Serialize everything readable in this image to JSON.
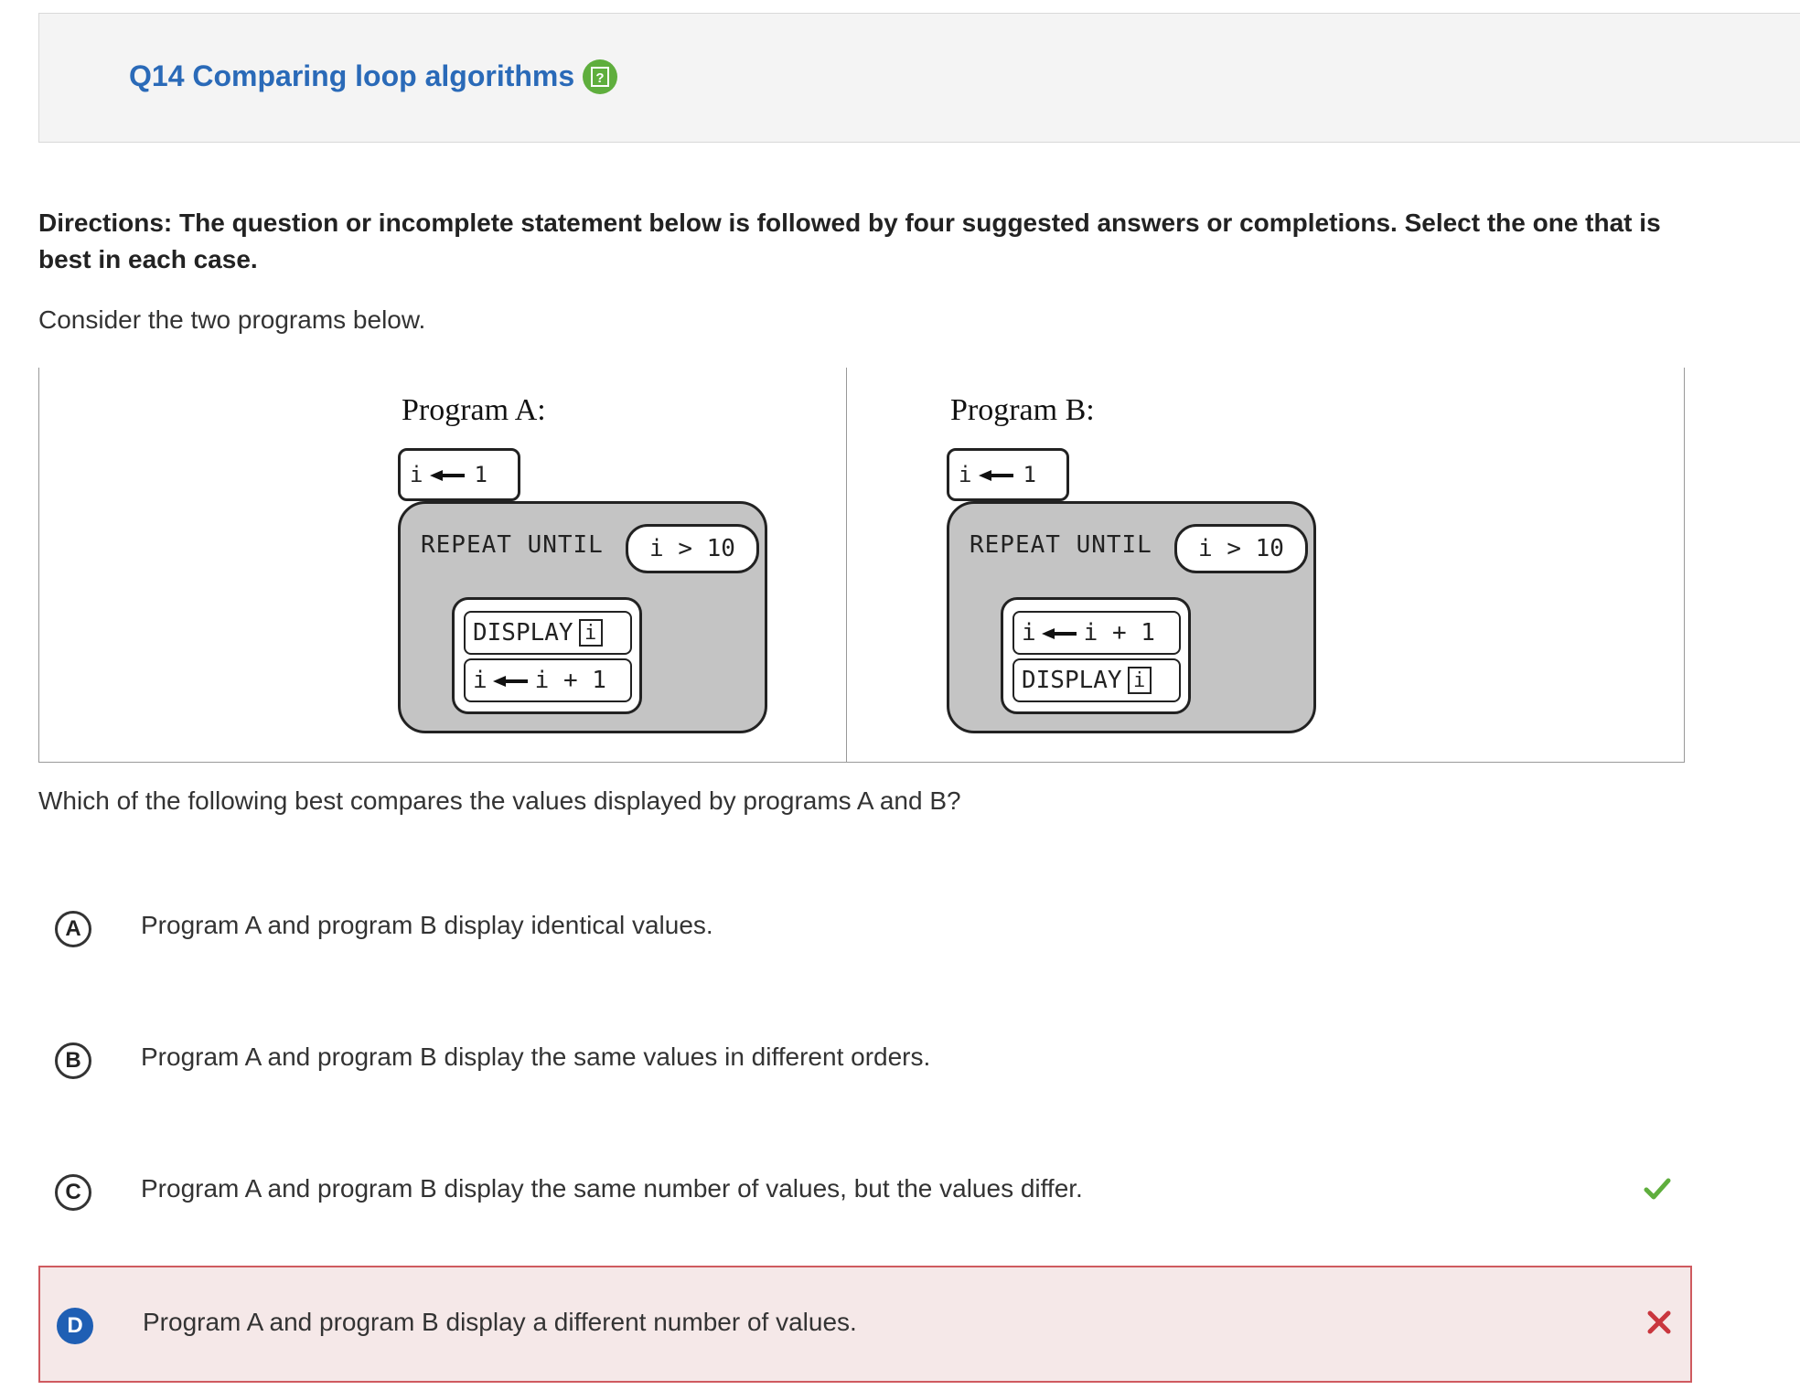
{
  "header": {
    "title": "Q14 Comparing loop algorithms",
    "help_icon": "help-question-icon"
  },
  "directions": "Directions: The question or incomplete statement below is followed by four suggested answers or completions. Select the one that is best in each case.",
  "prompt": "Consider the two programs below.",
  "programs": {
    "a": {
      "label": "Program A:",
      "init_var": "i",
      "init_val": "1",
      "repeat": "REPEAT UNTIL",
      "condition": "i > 10",
      "stmt1_keyword": "DISPLAY",
      "stmt1_var": "i",
      "stmt2_var": "i",
      "stmt2_expr": "i + 1"
    },
    "b": {
      "label": "Program B:",
      "init_var": "i",
      "init_val": "1",
      "repeat": "REPEAT UNTIL",
      "condition": "i > 10",
      "stmt1_var": "i",
      "stmt1_expr": "i + 1",
      "stmt2_keyword": "DISPLAY",
      "stmt2_var": "i"
    }
  },
  "question": "Which of the following best compares the values displayed by programs A and B?",
  "options": [
    {
      "letter": "A",
      "text": "Program A and program B display identical values."
    },
    {
      "letter": "B",
      "text": "Program A and program B display the same values in different orders."
    },
    {
      "letter": "C",
      "text": "Program A and program B display the same number of values, but the values differ.",
      "mark": "check-icon"
    },
    {
      "letter": "D",
      "text": "Program A and program B display a different number of values.",
      "mark": "x-icon",
      "selected": true
    }
  ],
  "colors": {
    "link_blue": "#2a6ab8",
    "correct_green": "#5fae3d",
    "wrong_red": "#c9363e",
    "selected_bg": "#f5e8e8"
  }
}
